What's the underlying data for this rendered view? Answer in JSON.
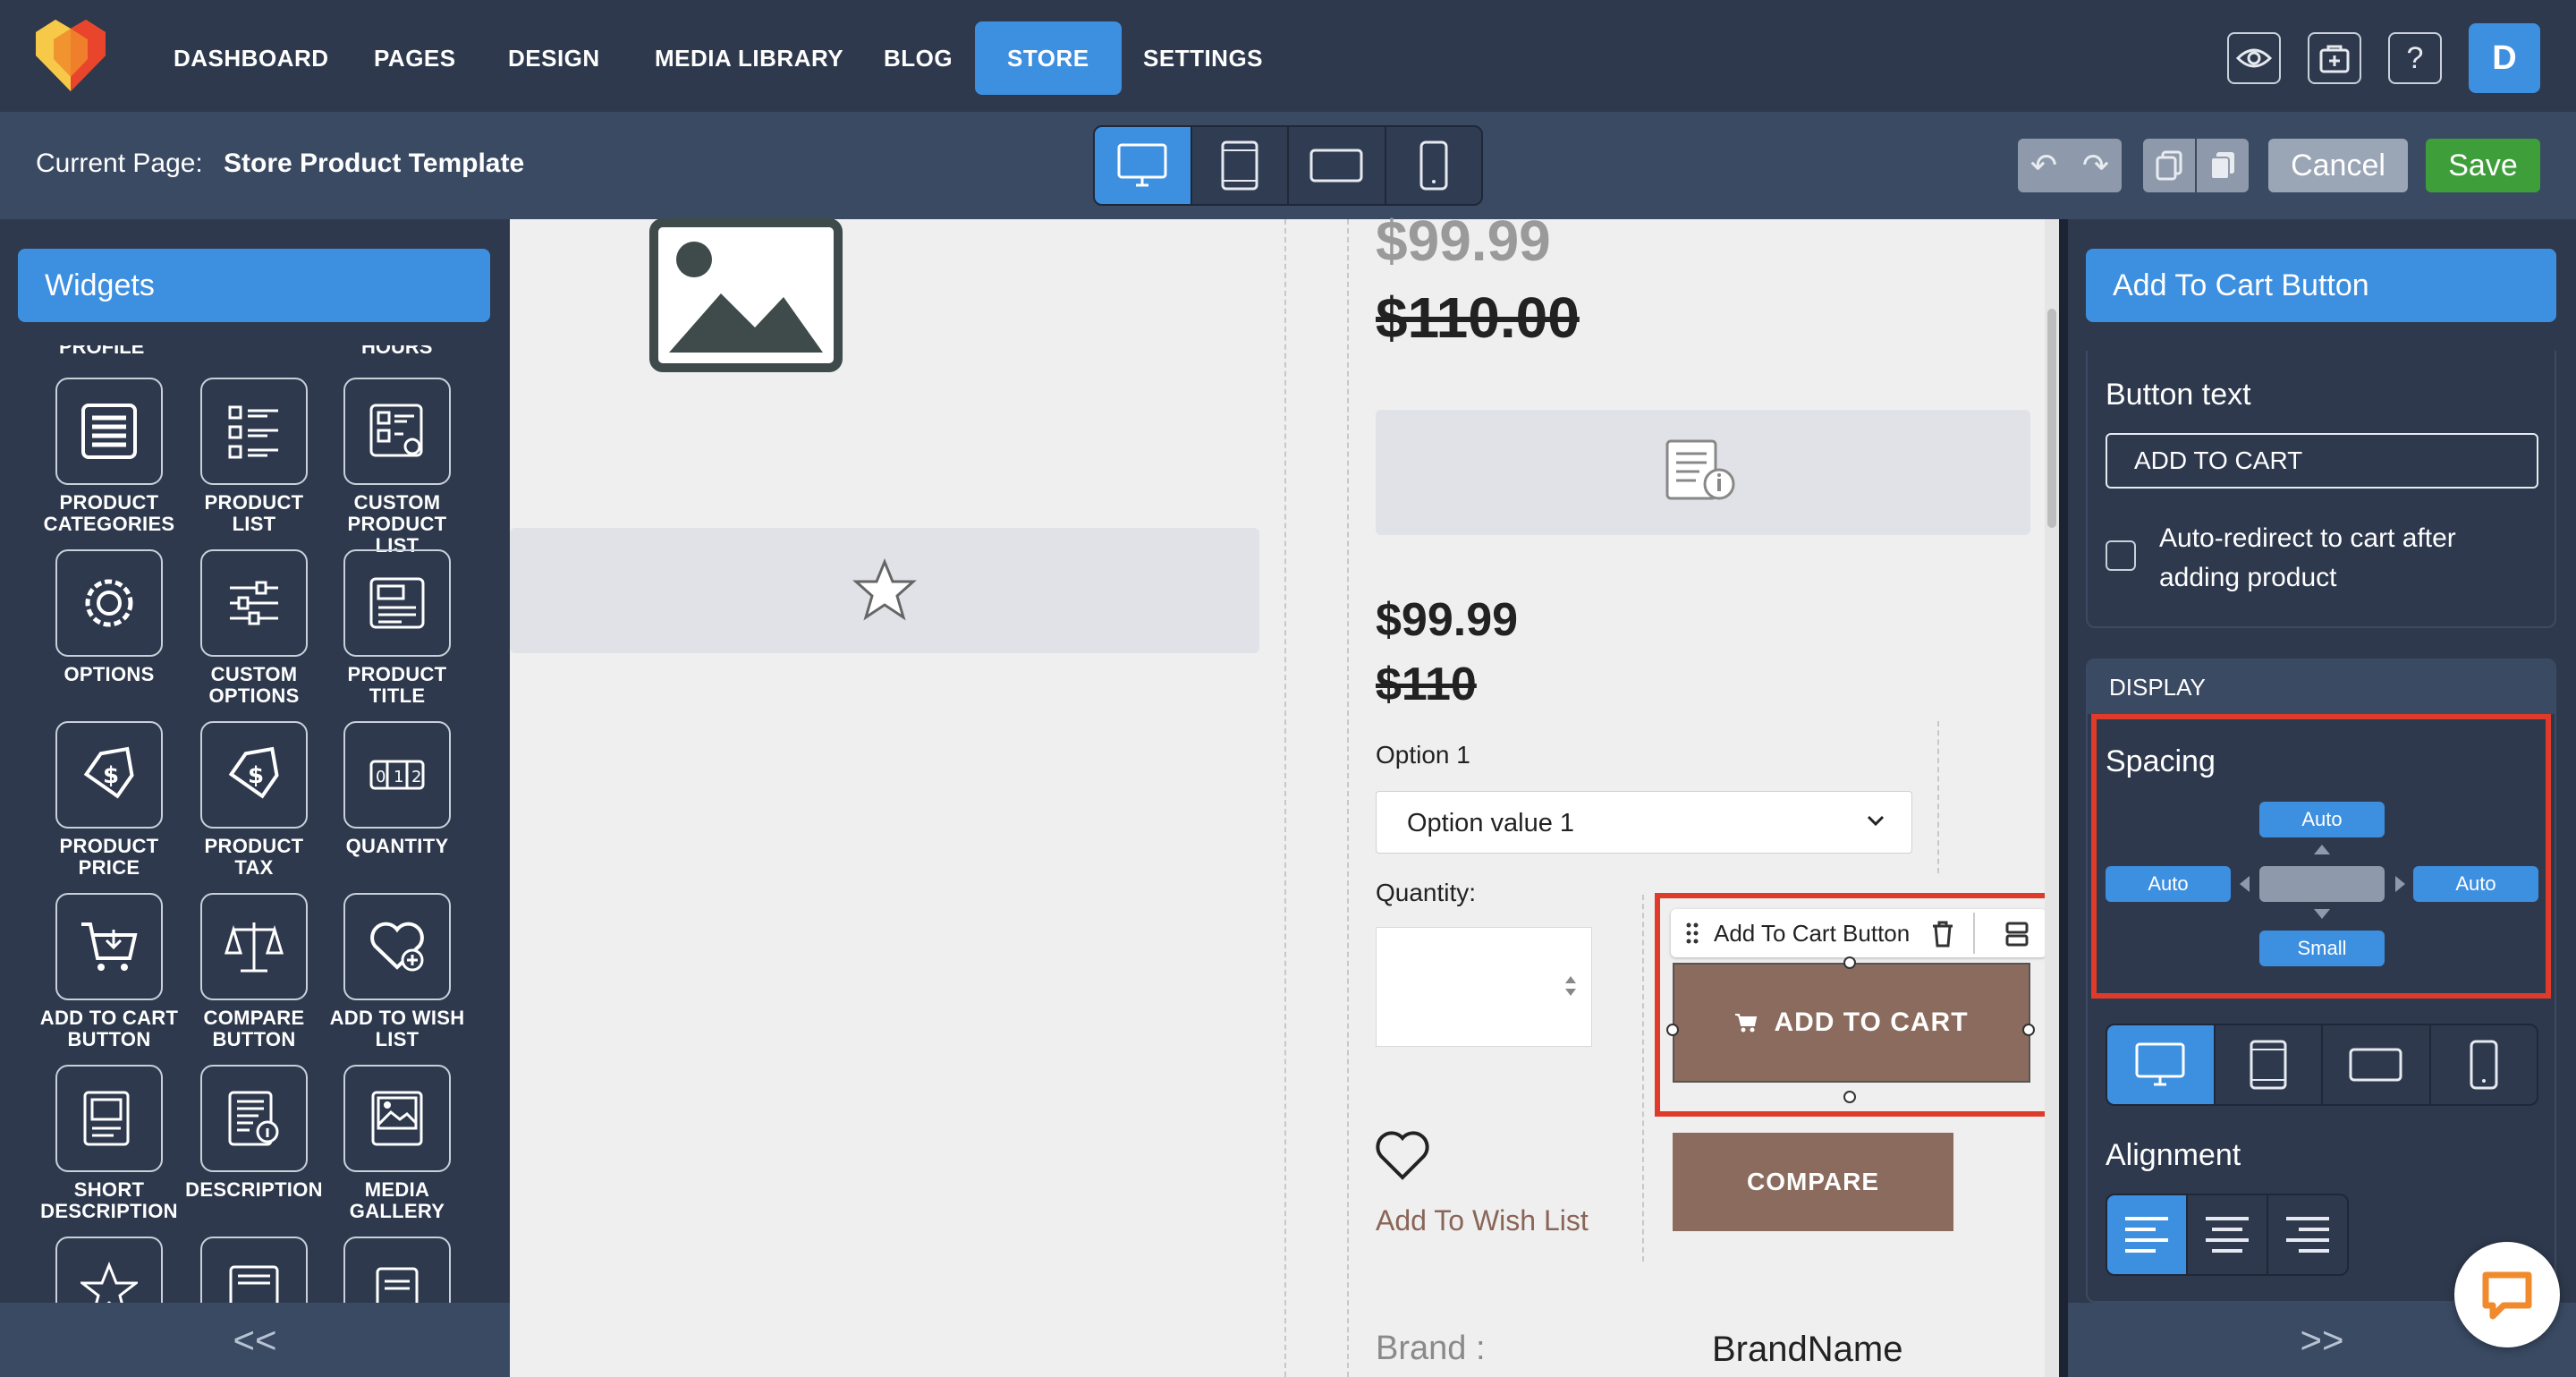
{
  "nav": {
    "items": [
      {
        "label": "DASHBOARD",
        "active": false
      },
      {
        "label": "PAGES",
        "active": false
      },
      {
        "label": "DESIGN",
        "active": false
      },
      {
        "label": "MEDIA LIBRARY",
        "active": false
      },
      {
        "label": "BLOG",
        "active": false
      },
      {
        "label": "STORE",
        "active": true
      },
      {
        "label": "SETTINGS",
        "active": false
      }
    ],
    "icons": [
      "eye-icon",
      "store-icon",
      "help-icon"
    ],
    "help_glyph": "?",
    "avatar_letter": "D",
    "accent_color": "#3d8fe0"
  },
  "subbar": {
    "current_page_label": "Current Page:",
    "current_page_value": "Store Product Template",
    "devices": [
      "desktop",
      "tablet-portrait",
      "tablet-landscape",
      "mobile"
    ],
    "active_device": "desktop",
    "cancel_label": "Cancel",
    "save_label": "Save"
  },
  "left_panel": {
    "title": "Widgets",
    "partial_labels": [
      "PROFILE",
      "HOURS"
    ],
    "widgets": [
      {
        "label": "PRODUCT CATEGORIES",
        "icon": "product-categories-icon"
      },
      {
        "label": "PRODUCT LIST",
        "icon": "product-list-icon"
      },
      {
        "label": "CUSTOM PRODUCT LIST",
        "icon": "custom-product-list-icon"
      },
      {
        "label": "OPTIONS",
        "icon": "options-icon"
      },
      {
        "label": "CUSTOM OPTIONS",
        "icon": "custom-options-icon"
      },
      {
        "label": "PRODUCT TITLE",
        "icon": "product-title-icon"
      },
      {
        "label": "PRODUCT PRICE",
        "icon": "product-price-icon"
      },
      {
        "label": "PRODUCT TAX",
        "icon": "product-tax-icon"
      },
      {
        "label": "QUANTITY",
        "icon": "quantity-icon"
      },
      {
        "label": "ADD TO CART BUTTON",
        "icon": "add-to-cart-icon"
      },
      {
        "label": "COMPARE BUTTON",
        "icon": "compare-icon"
      },
      {
        "label": "ADD TO WISH LIST",
        "icon": "wish-list-icon"
      },
      {
        "label": "SHORT DESCRIPTION",
        "icon": "short-description-icon"
      },
      {
        "label": "DESCRIPTION",
        "icon": "description-icon"
      },
      {
        "label": "MEDIA GALLERY",
        "icon": "media-gallery-icon"
      }
    ],
    "collapse_label": "<<"
  },
  "canvas": {
    "price_top": "$99.99",
    "old_price_top": "$110.00",
    "price": "$99.99",
    "old_price": "$110",
    "option_label": "Option 1",
    "option_value": "Option value 1",
    "quantity_label": "Quantity:",
    "atc_toolbar_label": "Add To Cart Button",
    "atc_button_label": "ADD TO CART",
    "compare_label": "COMPARE",
    "wish_label": "Add To Wish List",
    "brand_label": "Brand :",
    "brand_value": "BrandName",
    "button_color": "#8b6b5e",
    "highlight_color": "#e03a2a"
  },
  "right_panel": {
    "title": "Add To Cart Button",
    "button_text_label": "Button text",
    "button_text_value": "ADD TO CART",
    "auto_redirect_label": "Auto-redirect to cart after adding product",
    "auto_redirect_checked": false,
    "display_header": "DISPLAY",
    "spacing_label": "Spacing",
    "spacing": {
      "top": "Auto",
      "left": "Auto",
      "right": "Auto",
      "bottom": "Small"
    },
    "alignment_label": "Alignment",
    "alignment_options": [
      "left",
      "center",
      "right"
    ],
    "alignment_selected": "left",
    "collapse_label": ">>"
  }
}
